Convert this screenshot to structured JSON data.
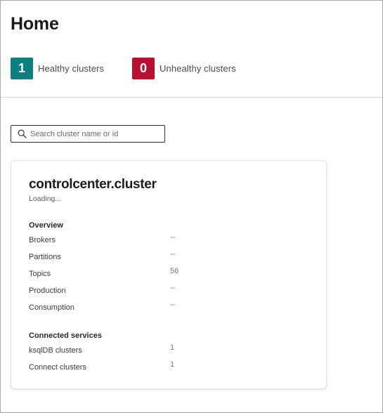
{
  "page": {
    "title": "Home"
  },
  "stats": {
    "healthy": {
      "count": "1",
      "label": "Healthy clusters",
      "color": "#0c7f80"
    },
    "unhealthy": {
      "count": "0",
      "label": "Unhealthy clusters",
      "color": "#b8102f"
    }
  },
  "search": {
    "placeholder": "Search cluster name or id",
    "value": "",
    "icon": "search-icon"
  },
  "cluster": {
    "name": "controlcenter.cluster",
    "status": "Loading...",
    "overview": {
      "heading": "Overview",
      "items": [
        {
          "label": "Brokers",
          "value": "--"
        },
        {
          "label": "Partitions",
          "value": "--"
        },
        {
          "label": "Topics",
          "value": "56"
        },
        {
          "label": "Production",
          "value": "--"
        },
        {
          "label": "Consumption",
          "value": "--"
        }
      ]
    },
    "connected_services": {
      "heading": "Connected services",
      "items": [
        {
          "label": "ksqlDB clusters",
          "value": "1"
        },
        {
          "label": "Connect clusters",
          "value": "1"
        }
      ]
    }
  }
}
